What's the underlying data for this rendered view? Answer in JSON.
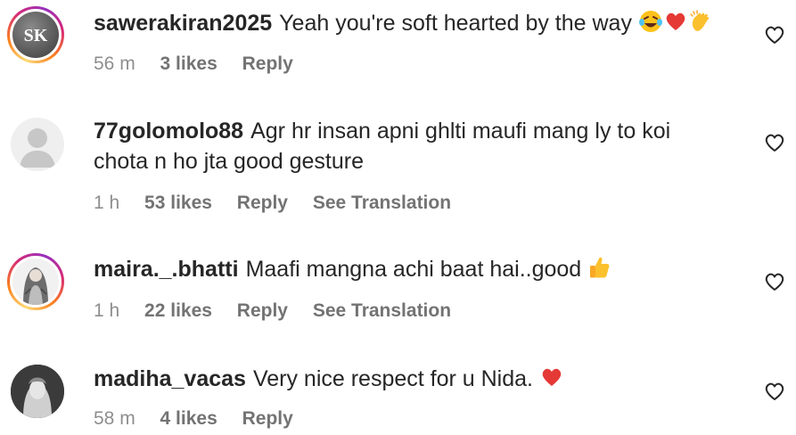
{
  "comments": [
    {
      "username": "sawerakiran2025",
      "text": "Yeah you're soft hearted by the way",
      "emojis": [
        "laughing-tears-emoji",
        "red-heart-emoji",
        "clapping-hands-emoji"
      ],
      "avatar_initials": "SK",
      "time": "56 m",
      "likes": "3 likes",
      "reply": "Reply"
    },
    {
      "username": "77golomolo88",
      "text": "Agr hr insan apni ghlti maufi mang ly to koi chota n ho jta good gesture",
      "time": "1 h",
      "likes": "53 likes",
      "reply": "Reply",
      "translation": "See Translation"
    },
    {
      "username": "maira._.bhatti",
      "text": "Maafi mangna achi baat hai..good",
      "emojis": [
        "thumbs-up-emoji"
      ],
      "time": "1 h",
      "likes": "22 likes",
      "reply": "Reply",
      "translation": "See Translation"
    },
    {
      "username": "madiha_vacas",
      "text": "Very nice respect for u Nida.",
      "emojis": [
        "red-heart-emoji"
      ],
      "time": "58 m",
      "likes": "4 likes",
      "reply": "Reply"
    }
  ],
  "colors": {
    "text": "#262626",
    "meta": "#8e8e8e",
    "story_ring": [
      "#feda75",
      "#fa7e1e",
      "#d62976",
      "#962fbf"
    ]
  }
}
